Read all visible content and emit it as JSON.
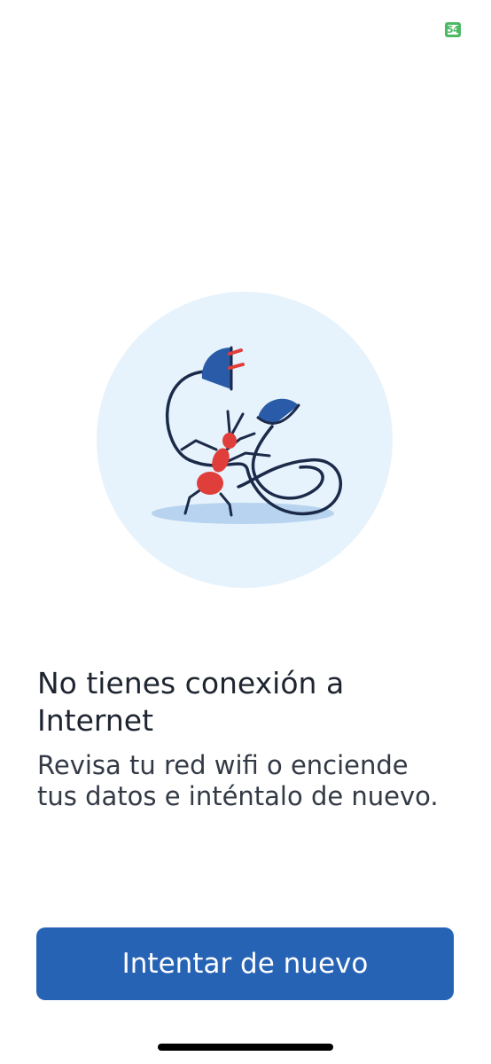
{
  "status_bar": {
    "badge_text": "54",
    "badge_color": "#4cb963"
  },
  "illustration": {
    "icon": "ant-unplugged-cable-icon",
    "circle_color": "#e6f3fc",
    "plug_color": "#2a5ba8",
    "ant_color": "#e03e3a",
    "cable_color": "#1c2a4a"
  },
  "error": {
    "title": "No tienes conexión a Internet",
    "message": "Revisa tu red wifi o enciende tus datos e inténtalo de nuevo."
  },
  "actions": {
    "retry_label": "Intentar de nuevo",
    "retry_color": "#2763b5"
  }
}
